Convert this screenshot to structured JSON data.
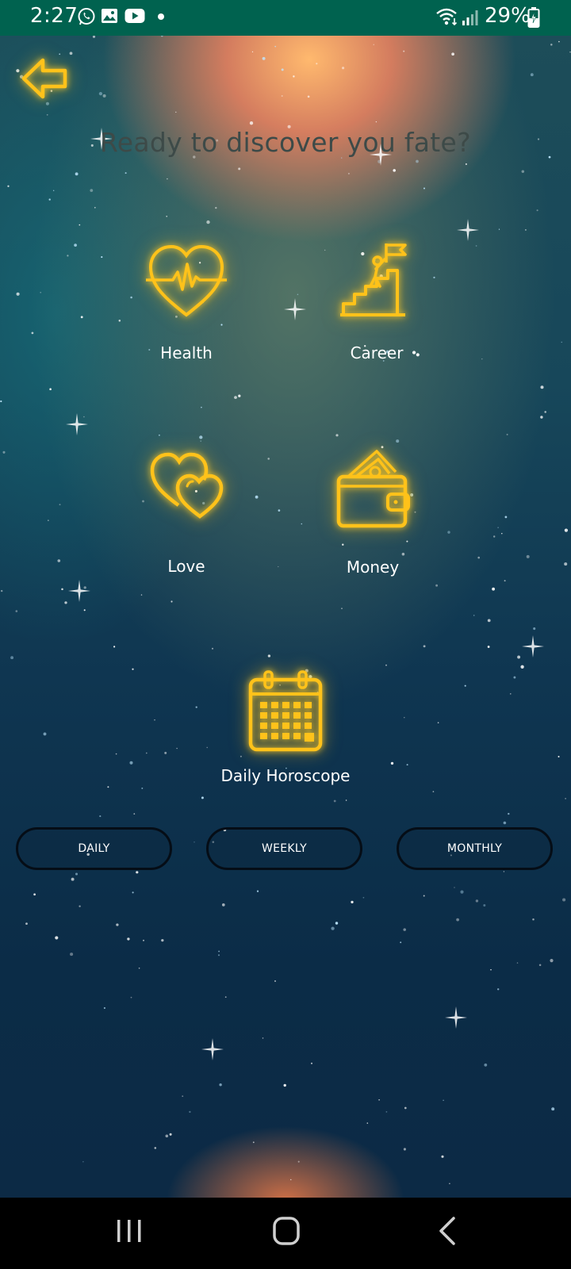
{
  "status_bar": {
    "time": "2:27",
    "battery": "29%",
    "icons": [
      "whatsapp-icon",
      "gallery-icon",
      "youtube-icon",
      "dot-icon",
      "wifi-icon",
      "signal-icon",
      "battery-charging-icon"
    ]
  },
  "header": {
    "back_icon": "back-arrow-icon",
    "title": "Ready to discover you fate?"
  },
  "categories": [
    {
      "label": "Health",
      "icon": "heartbeat-icon"
    },
    {
      "label": "Career",
      "icon": "career-icon"
    },
    {
      "label": "Love",
      "icon": "hearts-icon"
    },
    {
      "label": "Money",
      "icon": "wallet-icon"
    },
    {
      "label": "Daily Horoscope",
      "icon": "calendar-icon"
    }
  ],
  "periods": [
    {
      "label": "DAILY"
    },
    {
      "label": "WEEKLY"
    },
    {
      "label": "MONTHLY"
    }
  ],
  "nav_bar": {
    "icons": [
      "recent-apps-icon",
      "home-icon",
      "back-icon"
    ]
  },
  "colors": {
    "status_bar": "#00624f",
    "accent_gold": "#ffc21a",
    "title_text": "#3d4a48"
  }
}
